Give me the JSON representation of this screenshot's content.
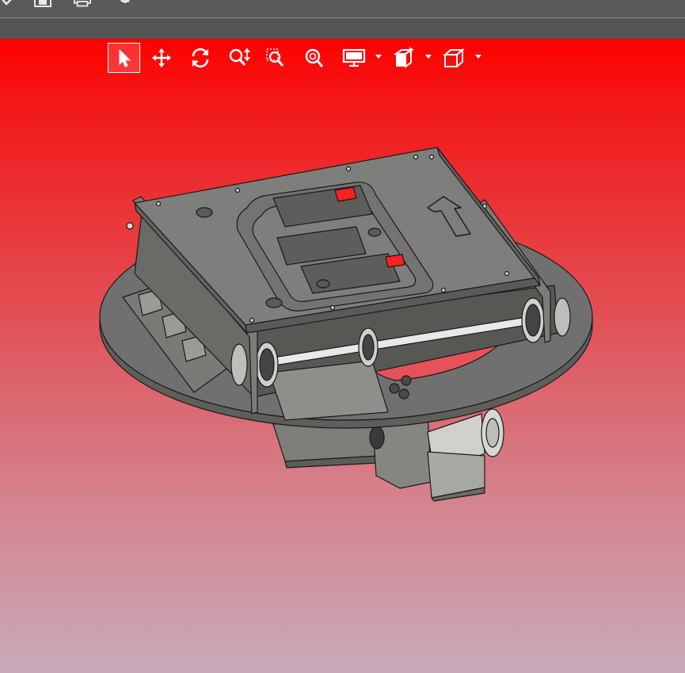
{
  "app": {
    "top_toolbar": {
      "items": [
        {
          "name": "open-icon"
        },
        {
          "name": "save-icon"
        },
        {
          "name": "print-icon"
        },
        {
          "name": "gear-icon"
        }
      ]
    },
    "viewport": {
      "background_top": "#ff0000",
      "background_bottom": "#c9aab9",
      "tools": [
        {
          "name": "select-pointer-icon",
          "active": true
        },
        {
          "name": "pan-move-icon"
        },
        {
          "name": "rotate-icon"
        },
        {
          "name": "zoom-dynamic-icon"
        },
        {
          "name": "zoom-area-icon"
        },
        {
          "name": "zoom-fit-icon"
        },
        {
          "name": "display-mode-icon",
          "dropdown": true
        },
        {
          "name": "section-view-icon",
          "dropdown": true
        },
        {
          "name": "view-orientation-cube-icon",
          "dropdown": true
        }
      ],
      "model": {
        "description_icon": "cad-assembly-rotating-platform",
        "body_color": "#6c6c6c",
        "highlight_color": "#ff2020"
      }
    }
  }
}
